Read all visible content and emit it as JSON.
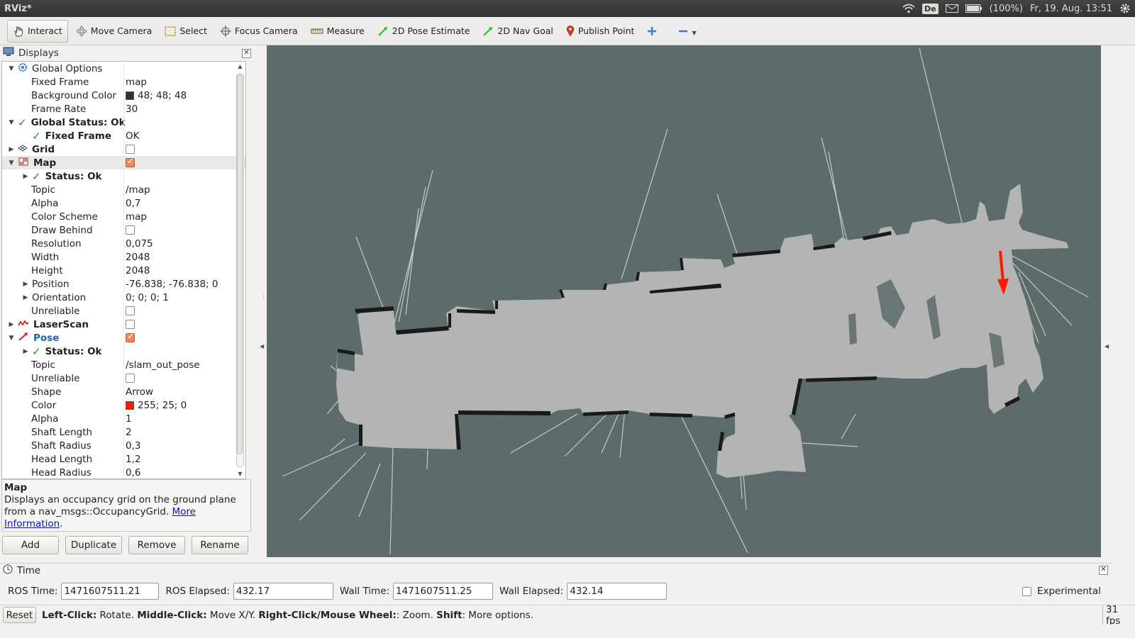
{
  "window": {
    "title": "RViz*"
  },
  "tray": {
    "keyboard": "De",
    "battery": "(100%)",
    "clock": "Fr, 19. Aug. 13:51"
  },
  "toolbar": {
    "tools": [
      {
        "label": "Interact",
        "icon": "hand-icon",
        "active": true
      },
      {
        "label": "Move Camera",
        "icon": "move-camera-icon"
      },
      {
        "label": "Select",
        "icon": "select-icon"
      },
      {
        "label": "Focus Camera",
        "icon": "focus-camera-icon"
      },
      {
        "label": "Measure",
        "icon": "ruler-icon"
      },
      {
        "label": "2D Pose Estimate",
        "icon": "green-arrow-icon"
      },
      {
        "label": "2D Nav Goal",
        "icon": "green-arrow-icon"
      },
      {
        "label": "Publish Point",
        "icon": "map-pin-icon"
      }
    ]
  },
  "displays": {
    "title": "Displays",
    "rows": [
      {
        "name": "Global Options",
        "value": "",
        "level": 0,
        "arrow": "down",
        "icon": "gear-icon"
      },
      {
        "name": "Fixed Frame",
        "value": "map",
        "level": 1
      },
      {
        "name": "Background Color",
        "value": "48; 48; 48",
        "level": 1,
        "swatch": "#303030"
      },
      {
        "name": "Frame Rate",
        "value": "30",
        "level": 1
      },
      {
        "name": "Global Status: Ok",
        "value": "",
        "level": 0,
        "arrow": "down",
        "status": true
      },
      {
        "name": "Fixed Frame",
        "value": "OK",
        "level": 1,
        "status": true
      },
      {
        "name": "Grid",
        "value": "",
        "level": 0,
        "arrow": "right",
        "icon": "grid-icon",
        "checkbox": false,
        "bold": true
      },
      {
        "name": "Map",
        "value": "",
        "level": 0,
        "arrow": "down",
        "icon": "map-icon",
        "checkbox": true,
        "bold": true,
        "selected": true
      },
      {
        "name": "Status: Ok",
        "value": "",
        "level": 1,
        "arrow": "right",
        "status": true
      },
      {
        "name": "Topic",
        "value": "/map",
        "level": 1
      },
      {
        "name": "Alpha",
        "value": "0,7",
        "level": 1
      },
      {
        "name": "Color Scheme",
        "value": "map",
        "level": 1
      },
      {
        "name": "Draw Behind",
        "value": "",
        "level": 1,
        "checkbox": false
      },
      {
        "name": "Resolution",
        "value": "0,075",
        "level": 1
      },
      {
        "name": "Width",
        "value": "2048",
        "level": 1
      },
      {
        "name": "Height",
        "value": "2048",
        "level": 1
      },
      {
        "name": "Position",
        "value": "-76.838; -76.838; 0",
        "level": 1,
        "arrow": "right"
      },
      {
        "name": "Orientation",
        "value": "0; 0; 0; 1",
        "level": 1,
        "arrow": "right"
      },
      {
        "name": "Unreliable",
        "value": "",
        "level": 1,
        "checkbox": false
      },
      {
        "name": "LaserScan",
        "value": "",
        "level": 0,
        "arrow": "right",
        "icon": "laserscan-icon",
        "checkbox": false,
        "bold": true
      },
      {
        "name": "Pose",
        "value": "",
        "level": 0,
        "arrow": "down",
        "icon": "pose-icon",
        "checkbox": true,
        "bold": true,
        "blue": true
      },
      {
        "name": "Status: Ok",
        "value": "",
        "level": 1,
        "arrow": "right",
        "status": true
      },
      {
        "name": "Topic",
        "value": "/slam_out_pose",
        "level": 1
      },
      {
        "name": "Unreliable",
        "value": "",
        "level": 1,
        "checkbox": false
      },
      {
        "name": "Shape",
        "value": "Arrow",
        "level": 1
      },
      {
        "name": "Color",
        "value": "255; 25; 0",
        "level": 1,
        "swatch": "#ff1900"
      },
      {
        "name": "Alpha",
        "value": "1",
        "level": 1
      },
      {
        "name": "Shaft Length",
        "value": "2",
        "level": 1
      },
      {
        "name": "Shaft Radius",
        "value": "0,3",
        "level": 1
      },
      {
        "name": "Head Length",
        "value": "1,2",
        "level": 1
      },
      {
        "name": "Head Radius",
        "value": "0,6",
        "level": 1
      }
    ]
  },
  "description": {
    "heading": "Map",
    "text": "Displays an occupancy grid on the ground plane from a nav_msgs::OccupancyGrid.",
    "link": "More Information",
    "after": "."
  },
  "buttons": {
    "add": "Add",
    "duplicate": "Duplicate",
    "remove": "Remove",
    "rename": "Rename"
  },
  "time": {
    "title": "Time",
    "ros_time_label": "ROS Time:",
    "ros_time": "1471607511.21",
    "ros_elapsed_label": "ROS Elapsed:",
    "ros_elapsed": "432.17",
    "wall_time_label": "Wall Time:",
    "wall_time": "1471607511.25",
    "wall_elapsed_label": "Wall Elapsed:",
    "wall_elapsed": "432.14",
    "experimental_label": "Experimental"
  },
  "status": {
    "reset": "Reset",
    "hint_parts": [
      {
        "text": "Left-Click:",
        "bold": true
      },
      {
        "text": " Rotate. ",
        "bold": false
      },
      {
        "text": "Middle-Click:",
        "bold": true
      },
      {
        "text": " Move X/Y. ",
        "bold": false
      },
      {
        "text": "Right-Click/Mouse Wheel:",
        "bold": true
      },
      {
        "text": ": Zoom. ",
        "bold": false
      },
      {
        "text": "Shift",
        "bold": true
      },
      {
        "text": ": More options.",
        "bold": false
      }
    ],
    "fps": "31 fps"
  },
  "colors": {
    "viewport_bg": "#5c6b6b",
    "map_free": "#b4b4b4",
    "pose_arrow": "#ff1900"
  }
}
